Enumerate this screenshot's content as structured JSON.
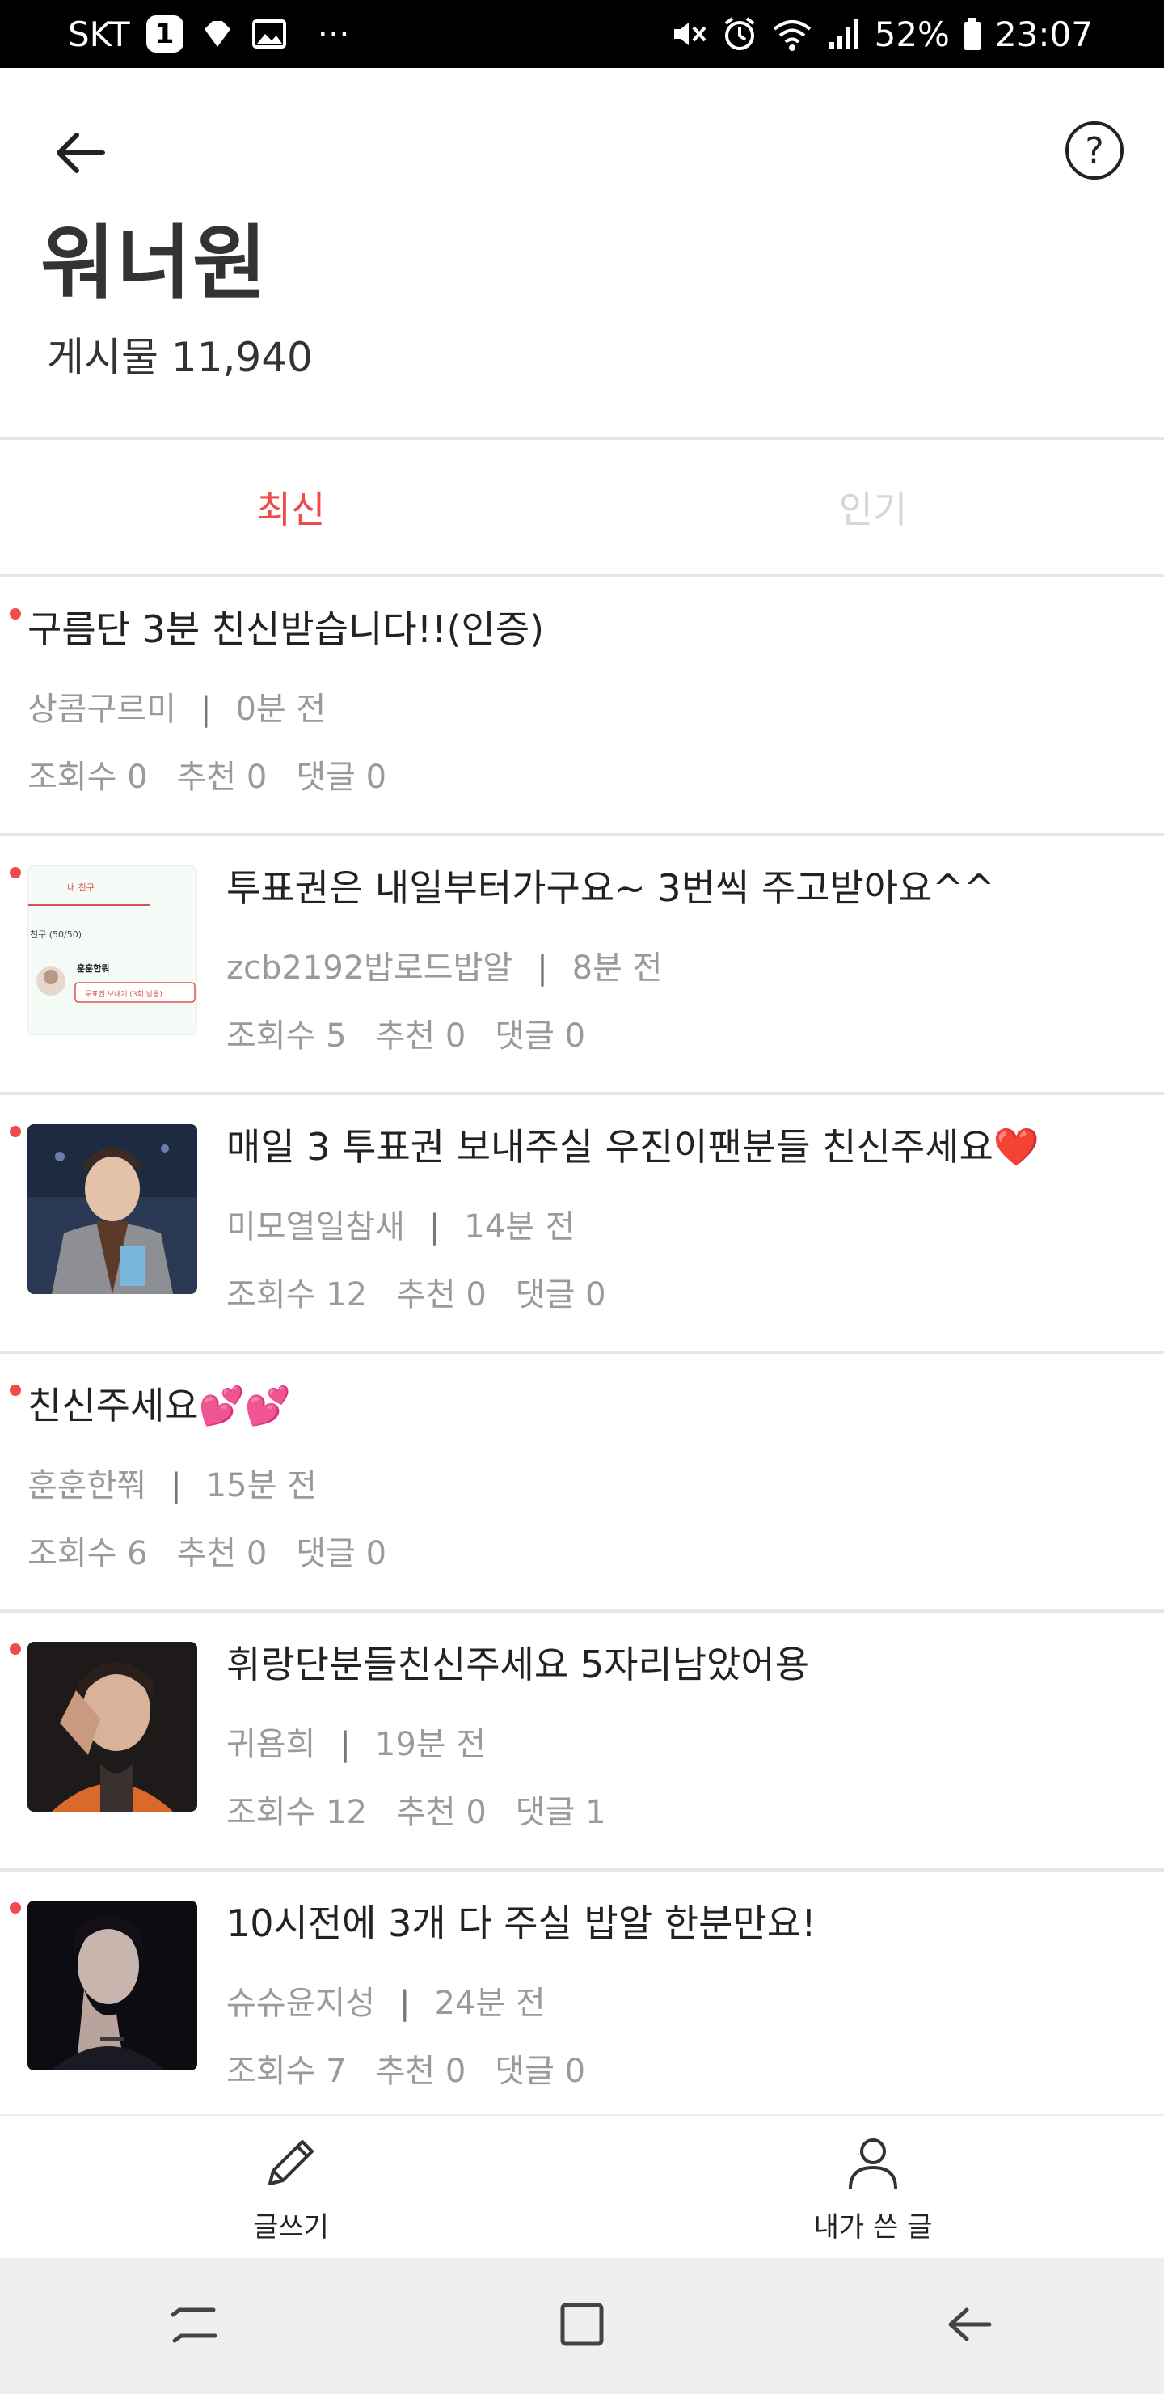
{
  "status_bar": {
    "carrier": "SKT",
    "badge": "1",
    "dots": "···",
    "battery": "52%",
    "time": "23:07"
  },
  "header": {
    "title": "워너원",
    "post_count_label": "게시물 11,940",
    "back_icon": "arrow-left-icon",
    "help_icon": "question-circle-icon",
    "help_glyph": "?"
  },
  "tabs": [
    {
      "label": "최신",
      "active": true
    },
    {
      "label": "인기",
      "active": false
    }
  ],
  "posts": [
    {
      "title": "구름단 3분 친신받습니다!!(인증)",
      "author": "상콤구르미",
      "time": "0분 전",
      "views": "조회수 0",
      "likes": "추천 0",
      "comments": "댓글 0",
      "has_image": false
    },
    {
      "title": "투표권은 내일부터가구요~  3번씩 주고받아요^^",
      "author": "zcb2192밥로드밥알",
      "time": "8분 전",
      "views": "조회수 5",
      "likes": "추천 0",
      "comments": "댓글 0",
      "has_image": true,
      "image_text": {
        "tab": "내 친구",
        "friends": "친구 (50/50)",
        "name": "훈훈한뭐",
        "button": "투표권 보내기 (3회 남음)"
      }
    },
    {
      "title": "매일 3 투표권 보내주실 우진이팬분들 친신주세요❤️",
      "author": "미모열일참새",
      "time": "14분 전",
      "views": "조회수 12",
      "likes": "추천 0",
      "comments": "댓글 0",
      "has_image": true
    },
    {
      "title": "친신주세요💕💕",
      "author": "훈훈한쭤",
      "time": "15분 전",
      "views": "조회수 6",
      "likes": "추천 0",
      "comments": "댓글 0",
      "has_image": false
    },
    {
      "title": "휘랑단분들친신주세요 5자리남았어용",
      "author": "귀욤희",
      "time": "19분 전",
      "views": "조회수 12",
      "likes": "추천 0",
      "comments": "댓글 1",
      "has_image": true
    },
    {
      "title": "10시전에 3개 다 주실 밥알 한분만요!",
      "author": "슈슈윤지성",
      "time": "24분 전",
      "views": "조회수 7",
      "likes": "추천 0",
      "comments": "댓글 0",
      "has_image": true
    }
  ],
  "separator": "|",
  "bottom_bar": {
    "write_label": "글쓰기",
    "write_icon": "pencil-icon",
    "my_posts_label": "내가 쓴 글",
    "my_posts_icon": "person-icon"
  },
  "colors": {
    "accent": "#f04a4a",
    "divider": "#e6e6e6",
    "meta_text": "#9a9a9a"
  }
}
